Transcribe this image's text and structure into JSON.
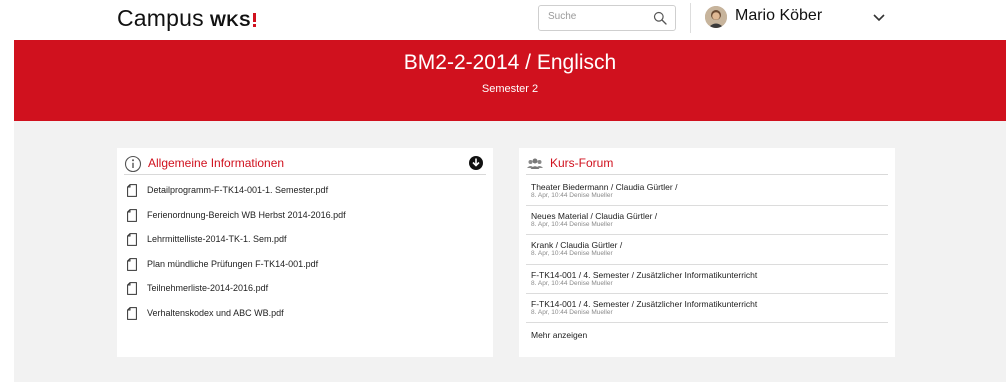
{
  "header": {
    "brand_name": "Campus",
    "brand_mark": "WKS",
    "search_placeholder": "Suche",
    "user_name": "Mario Köber",
    "icons": {
      "search": "search-icon",
      "avatar": "avatar",
      "menu": "chevron-down-icon"
    }
  },
  "banner": {
    "title": "BM2-2-2014 / Englisch",
    "subtitle": "Semester 2",
    "color": "#d0111e"
  },
  "info": {
    "title": "Allgemeine Informationen",
    "icon": "info-icon",
    "download_icon": "download-icon",
    "files": [
      "Detailprogramm-F-TK14-001-1. Semester.pdf",
      "Ferienordnung-Bereich WB Herbst 2014-2016.pdf",
      "Lehrmittelliste-2014-TK-1. Sem.pdf",
      "Plan mündliche Prüfungen F-TK14-001.pdf",
      "Teilnehmerliste-2014-2016.pdf",
      "Verhaltenskodex und ABC WB.pdf"
    ]
  },
  "forum": {
    "title": "Kurs-Forum",
    "icon": "users-icon",
    "posts": [
      {
        "title": "Theater Biedermann / Claudia Gürtler /",
        "meta": "8. Apr, 10:44  Denise Mueller"
      },
      {
        "title": "Neues Material / Claudia Gürtler /",
        "meta": "8. Apr, 10:44  Denise Mueller"
      },
      {
        "title": "Krank / Claudia Gürtler /",
        "meta": "8. Apr, 10:44  Denise Mueller"
      },
      {
        "title": "F-TK14-001 / 4. Semester / Zusätzlicher Informatikunterricht",
        "meta": "8. Apr, 10:44  Denise Mueller"
      },
      {
        "title": "F-TK14-001 / 4. Semester / Zusätzlicher Informatikunterricht",
        "meta": "8. Apr, 10:44  Denise Mueller"
      }
    ],
    "more_label": "Mehr anzeigen"
  },
  "colors": {
    "accent": "#d0111e",
    "page_bg": "#f2f2f2"
  }
}
